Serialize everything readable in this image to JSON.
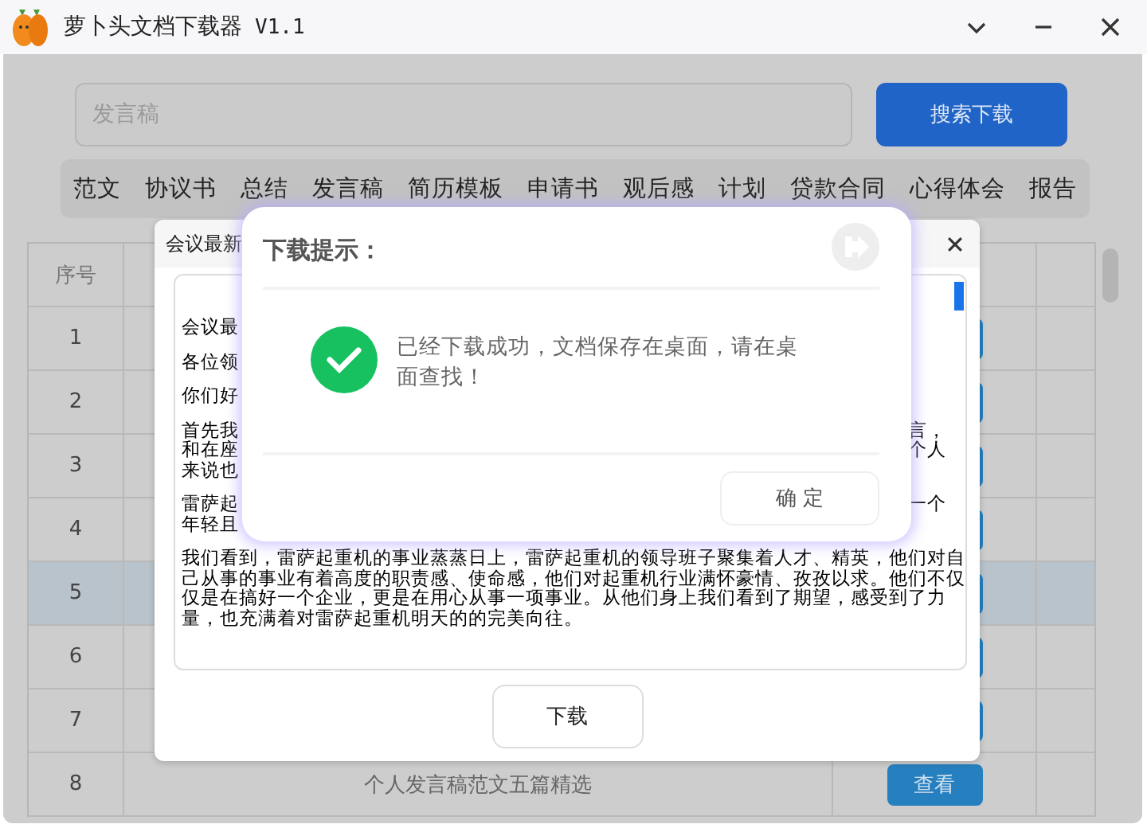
{
  "window": {
    "title": "萝卜头文档下载器",
    "version": "V1.1"
  },
  "search": {
    "placeholder": "发言稿",
    "button": "搜索下载"
  },
  "categories": [
    "范文",
    "协议书",
    "总结",
    "发言稿",
    "简历模板",
    "申请书",
    "观后感",
    "计划",
    "贷款合同",
    "心得体会",
    "报告"
  ],
  "table": {
    "header": "序号",
    "rows": [
      {
        "index": "1",
        "selected": false
      },
      {
        "index": "2",
        "selected": false
      },
      {
        "index": "3",
        "selected": false
      },
      {
        "index": "4",
        "selected": false
      },
      {
        "index": "5",
        "selected": true
      },
      {
        "index": "6",
        "selected": false
      },
      {
        "index": "7",
        "selected": false
      },
      {
        "index": "8",
        "selected": false,
        "title": "个人发言稿范文五篇精选",
        "action": "查看"
      }
    ]
  },
  "preview": {
    "title": "会议最新",
    "paragraphs": [
      {
        "lines": [
          {
            "left": "会议最"
          }
        ]
      },
      {
        "lines": [
          {
            "left": "各位领"
          }
        ]
      },
      {
        "lines": [
          {
            "left": "你们好"
          }
        ]
      },
      {
        "lines": [
          {
            "left": "首先我",
            "right": "言，"
          },
          {
            "left": "和在座",
            "right": "个人"
          },
          {
            "left": "来说也"
          }
        ]
      },
      {
        "lines": [
          {
            "left": "雷萨起",
            "right": "一个"
          },
          {
            "left": "年轻且"
          }
        ]
      },
      {
        "lines": [
          {
            "left": "我们看到，雷萨起重机的事业蒸蒸日上，雷萨起重机的领导班子聚集着人才、精英，他们对自"
          },
          {
            "left": "己从事的事业有着高度的职责感、使命感，他们对起重机行业满怀豪情、孜孜以求。他们不仅"
          },
          {
            "left": "仅是在搞好一个企业，更是在用心从事一项事业。从他们身上我们看到了期望，感受到了力"
          },
          {
            "left": "量，也充满着对雷萨起重机明天的的完美向往。"
          }
        ]
      }
    ],
    "button": "下载"
  },
  "toast": {
    "title": "下载提示：",
    "message": "已经下载成功，文档保存在桌面，请在桌面查找！",
    "button": "确 定"
  }
}
